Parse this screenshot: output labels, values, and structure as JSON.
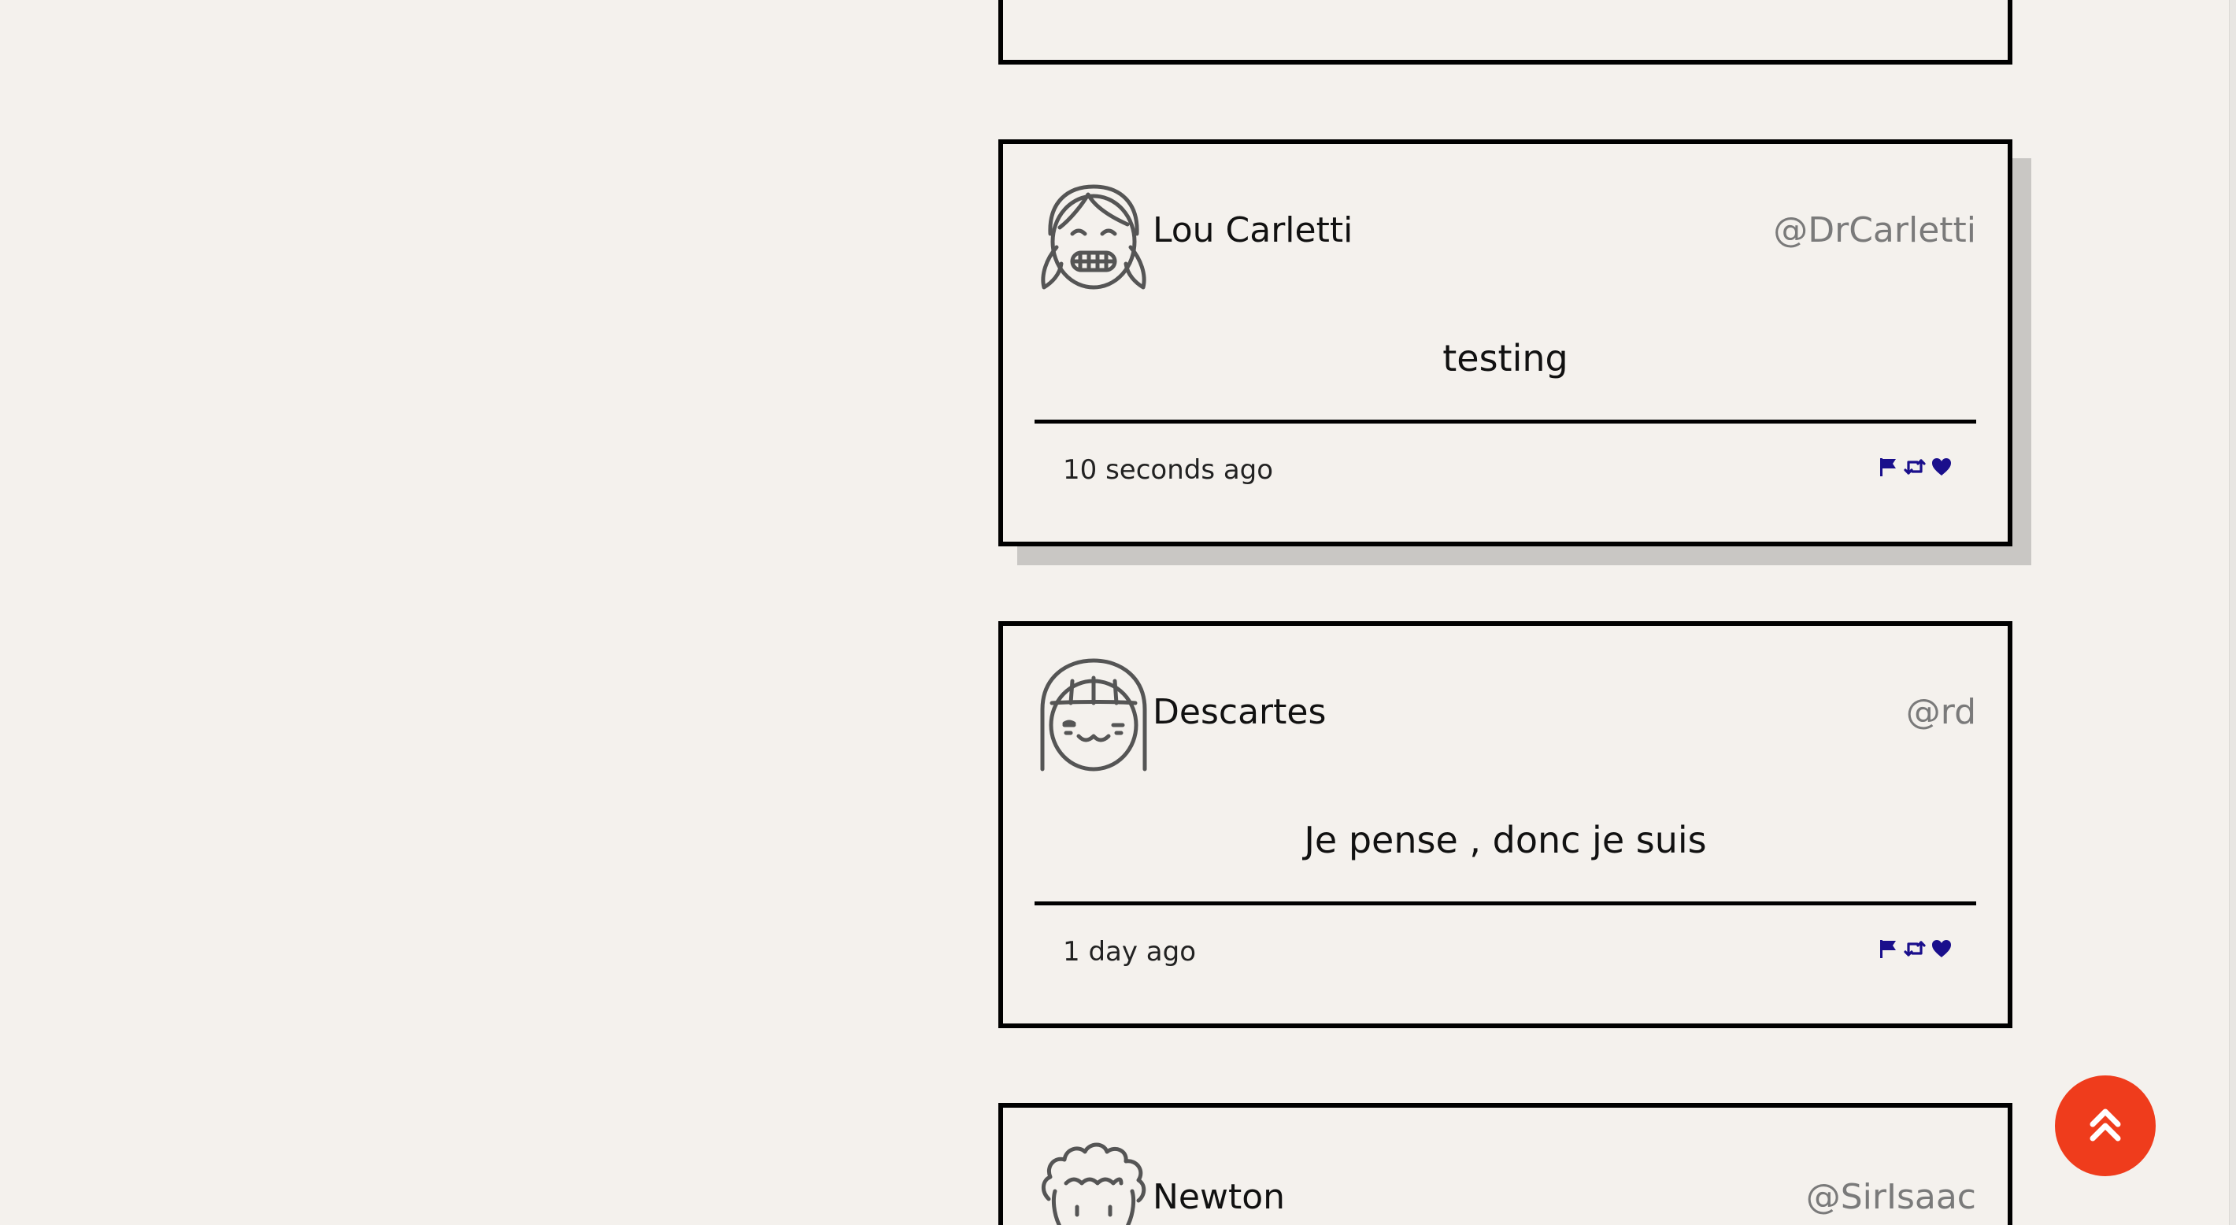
{
  "tweets": [
    {
      "display_name": "",
      "handle": "",
      "text": "",
      "timestamp": "",
      "avatar_icon": "avatar-icon"
    },
    {
      "display_name": "Lou Carletti",
      "handle": "@DrCarletti",
      "text": "testing",
      "timestamp": "10 seconds ago",
      "avatar_icon": "girl-pigtails-grin-avatar-icon"
    },
    {
      "display_name": "Descartes",
      "handle": "@rd",
      "text": "Je pense , donc je suis",
      "timestamp": "1 day ago",
      "avatar_icon": "girl-bob-smile-avatar-icon"
    },
    {
      "display_name": "Newton",
      "handle": "@SirIsaac",
      "text": "",
      "timestamp": "",
      "avatar_icon": "curly-hair-avatar-icon"
    }
  ],
  "actions": {
    "icons": [
      "flag-icon",
      "retweet-icon",
      "heart-icon"
    ],
    "color": "#1a0f8c"
  },
  "colors": {
    "background": "#f4f1ed",
    "border": "#000000",
    "handle": "#7a7a7a",
    "scroll_top_button": "#ef3c1c"
  },
  "scroll_top": {
    "icon": "double-chevron-up-icon"
  }
}
